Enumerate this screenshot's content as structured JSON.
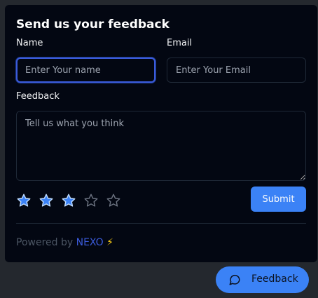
{
  "form": {
    "title": "Send us your feedback",
    "name_label": "Name",
    "name_placeholder": "Enter Your name",
    "email_label": "Email",
    "email_placeholder": "Enter Your Email",
    "feedback_label": "Feedback",
    "feedback_placeholder": "Tell us what you think",
    "rating": {
      "value": 3,
      "max": 5
    },
    "submit_label": "Submit"
  },
  "footer": {
    "powered_prefix": "Powered by",
    "brand": "NEXO",
    "bolt": "⚡"
  },
  "launcher": {
    "label": "Feedback",
    "icon": "chat-bubble-icon"
  },
  "colors": {
    "accent": "#3b82f6",
    "panel_bg": "#030712",
    "star_filled": "#3b82f6",
    "star_empty": "#6b7280",
    "brand": "#3b5bdb"
  }
}
